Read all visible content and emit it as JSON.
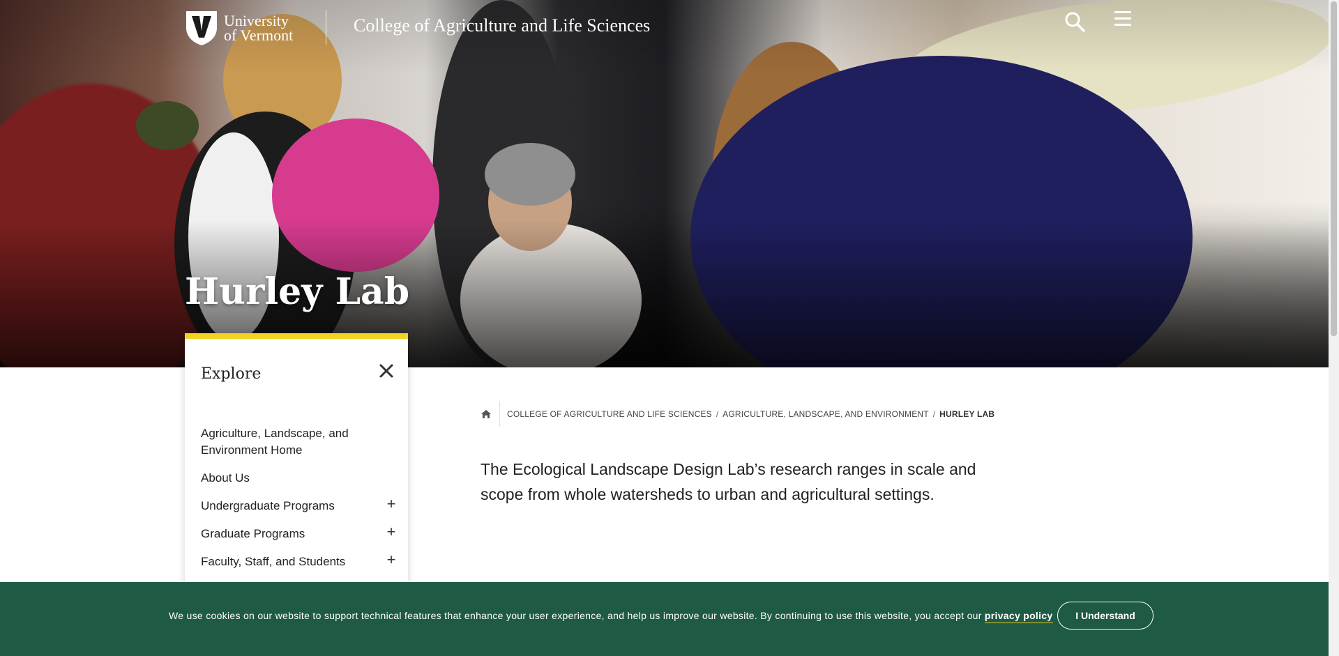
{
  "header": {
    "university_line1": "University",
    "university_line2": "of Vermont",
    "college_name": "College of Agriculture and Life Sciences",
    "search_icon": "search-icon",
    "menu_icon": "hamburger-menu-icon"
  },
  "hero": {
    "title": "Hurley Lab"
  },
  "explore": {
    "heading": "Explore",
    "close_icon": "close-icon",
    "items": [
      {
        "label": "Agriculture, Landscape, and Environment Home",
        "expandable": false
      },
      {
        "label": "About Us",
        "expandable": false
      },
      {
        "label": "Undergraduate Programs",
        "expandable": true
      },
      {
        "label": "Graduate Programs",
        "expandable": true
      },
      {
        "label": "Faculty, Staff, and Students",
        "expandable": true
      }
    ]
  },
  "breadcrumb": {
    "home_icon": "home-icon",
    "items": [
      "College of Agriculture and Life Sciences",
      "Agriculture, Landscape, and Environment",
      "Hurley Lab"
    ]
  },
  "main": {
    "intro": "The Ecological Landscape Design Lab’s research ranges in scale and scope from whole watersheds to urban and agricultural settings."
  },
  "cookie_banner": {
    "text": "We use cookies on our website to support technical features that enhance your user experience, and help us improve our website. By continuing to use this website, you accept our",
    "link_text": "privacy policy",
    "button_label": "I Understand",
    "background": "#1e5a44"
  },
  "colors": {
    "accent_yellow": "#f3d321",
    "banner_green": "#1e5a44"
  }
}
